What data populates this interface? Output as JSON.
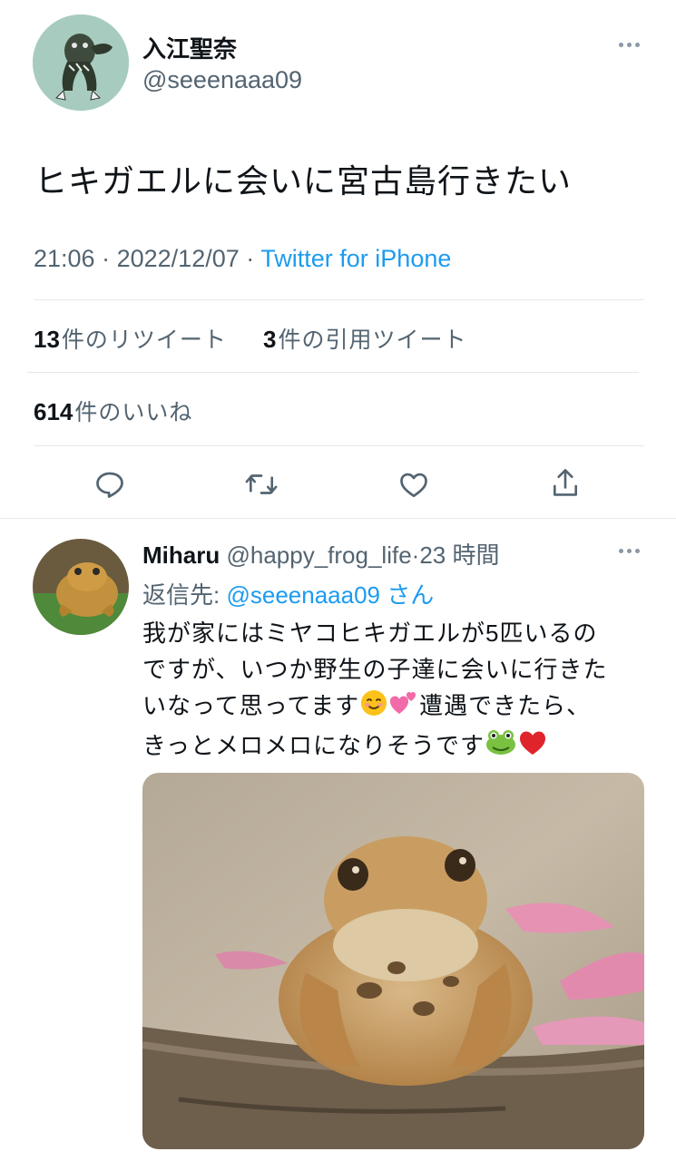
{
  "main_tweet": {
    "author_name": "入江聖奈",
    "author_handle": "@seeenaaa09",
    "text": "ヒキガエルに会いに宮古島行きたい",
    "time": "21:06",
    "date": "2022/12/07",
    "separator": "·",
    "source": "Twitter for iPhone",
    "retweets_count": "13",
    "retweets_label": "件のリツイート",
    "quotes_count": "3",
    "quotes_label": "件の引用ツイート",
    "likes_count": "614",
    "likes_label": "件のいいね",
    "avatar_icon": "frog-figure-avatar"
  },
  "actions": [
    {
      "icon": "reply-icon"
    },
    {
      "icon": "retweet-icon"
    },
    {
      "icon": "like-icon"
    },
    {
      "icon": "share-icon"
    }
  ],
  "reply": {
    "author_name": "Miharu",
    "author_handle": "@happy_frog_life",
    "separator": "·",
    "time_ago": "23 時間",
    "reply_to_label": "返信先:",
    "reply_to_handle": "@seeenaaa09",
    "reply_to_suffix": "さん",
    "text_line1": "我が家にはミヤコヒキガエルが5匹いるの",
    "text_line2": "ですが、いつか野生の子達に会いに行きた",
    "text_line3a": "いなって思ってます",
    "text_line3b": "遭遇できたら、",
    "text_line4": "きっとメロメロになりそうです",
    "emojis": [
      "relieved-smile-emoji",
      "two-hearts-emoji",
      "frog-emoji",
      "red-heart-emoji"
    ],
    "media": "toad-photo"
  },
  "colors": {
    "link": "#1d9bf0",
    "secondary_text": "#536471",
    "divider": "#e6e8ea"
  }
}
